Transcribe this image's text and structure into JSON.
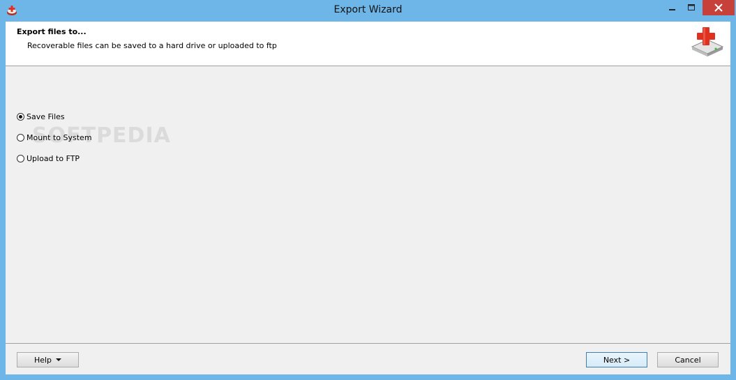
{
  "window": {
    "title": "Export Wizard",
    "icon": "app-logo-icon"
  },
  "header": {
    "title": "Export files to...",
    "subtitle": "Recoverable files can be saved to a hard drive or uploaded to ftp",
    "icon": "drive-plus-icon"
  },
  "options": [
    {
      "label": "Save Files",
      "checked": true
    },
    {
      "label": "Mount to System",
      "checked": false
    },
    {
      "label": "Upload to FTP",
      "checked": false
    }
  ],
  "watermark": "SOFTPEDIA",
  "buttons": {
    "help": "Help",
    "next": "Next >",
    "cancel": "Cancel"
  },
  "colors": {
    "titlebar": "#6fb6e8",
    "close": "#c7403a",
    "client": "#f0f0f0",
    "accent_red": "#e03020"
  }
}
